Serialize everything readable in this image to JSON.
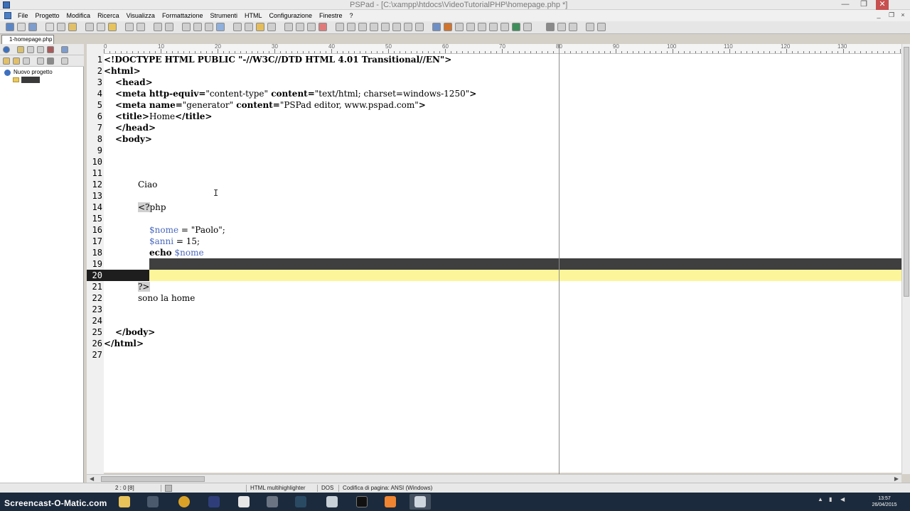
{
  "window": {
    "title": "PSPad - [C:\\xampp\\htdocs\\VideoTutorialPHP\\homepage.php *]",
    "minimize_label": "—",
    "maximize_label": "❐",
    "close_label": "✕"
  },
  "menu": {
    "items": [
      "File",
      "Progetto",
      "Modifica",
      "Ricerca",
      "Visualizza",
      "Formattazione",
      "Strumenti",
      "HTML",
      "Configurazione",
      "Finestre",
      "?"
    ]
  },
  "tabs": {
    "active": "1-homepage.php"
  },
  "project_panel": {
    "root": "Nuovo progetto"
  },
  "ruler": {
    "labels": [
      "0",
      "10",
      "20",
      "30",
      "40",
      "50",
      "60",
      "70",
      "80",
      "90",
      "100",
      "110",
      "120",
      "130"
    ]
  },
  "editor": {
    "line_numbers": [
      "1",
      "2",
      "3",
      "4",
      "5",
      "6",
      "7",
      "8",
      "9",
      "10",
      "11",
      "12",
      "13",
      "14",
      "15",
      "16",
      "17",
      "18",
      "19",
      "20",
      "21",
      "22",
      "23",
      "24",
      "25",
      "26",
      "27"
    ],
    "lines": {
      "l1": "<!DOCTYPE HTML PUBLIC \"-//W3C//DTD HTML 4.01 Transitional//EN\">",
      "l2": "<html>",
      "l3": "<head>",
      "l4_tag": "<meta http-equiv=",
      "l4_val": "\"content-type\"",
      "l4_attr": " content=",
      "l4_val2": "\"text/html; charset=windows-1250\"",
      "l4_end": ">",
      "l5_tag": "<meta name=",
      "l5_val": "\"generator\"",
      "l5_attr": " content=",
      "l5_val2": "\"PSPad editor, www.pspad.com\"",
      "l5_end": ">",
      "l6_open": "<title>",
      "l6_text": "Home",
      "l6_close": "</title>",
      "l7": "</head>",
      "l8": "<body>",
      "l12": "Ciao",
      "l14_tag": "<?",
      "l14_rest": "php",
      "l16_var": "$nome",
      "l16_rest": " = \"Paolo\";",
      "l17_var": "$anni",
      "l17_rest": " = 15;",
      "l18_kw": "echo",
      "l18_var": " $nome",
      "l21": "?>",
      "l22": "sono la home",
      "l25": "</body>",
      "l26": "</html>"
    }
  },
  "status": {
    "position": "2 : 0  [8]",
    "highlighter": "HTML multihighlighter",
    "eol": "DOS",
    "encoding": "Codifica di pagina: ANSI (Windows)"
  },
  "taskbar": {
    "watermark": "Screencast-O-Matic.com",
    "time": "13:57",
    "date": "26/04/2015"
  },
  "colors": {
    "current_line": "#fdf59a",
    "selection": "#3f3f3f",
    "php_variable": "#4a69bd",
    "taskbar": "#1b2a3c"
  }
}
